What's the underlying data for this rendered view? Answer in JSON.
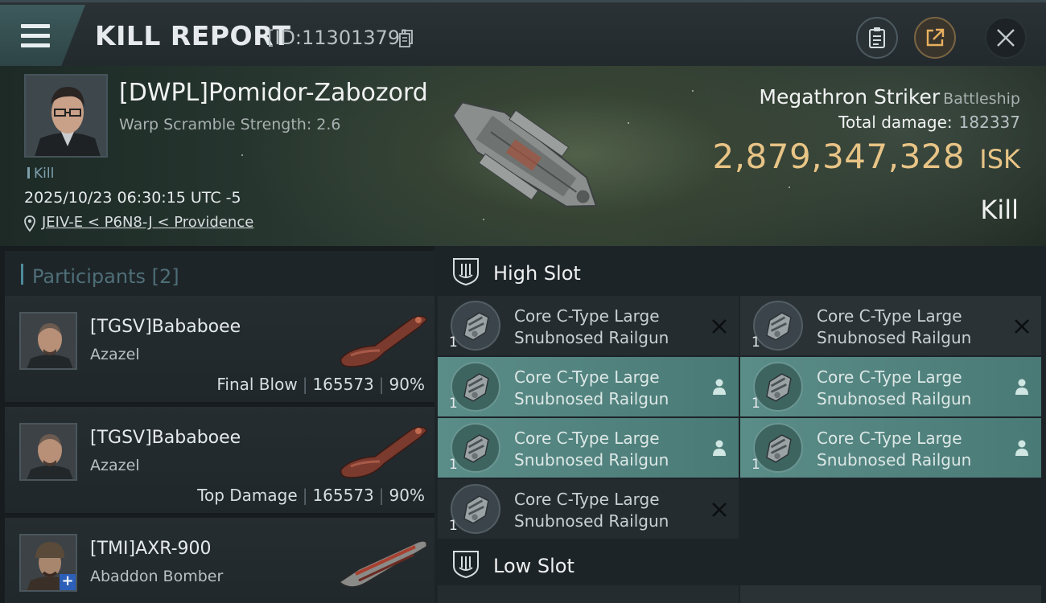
{
  "header": {
    "title": "KILL REPORT",
    "id_text": "[ID:11301379]"
  },
  "victim": {
    "name": "[DWPL]Pomidor-Zabozord",
    "warp_scramble": "Warp Scramble Strength: 2.6",
    "tag": "Kill",
    "datetime": "2025/10/23 06:30:15 UTC -5",
    "location": "JEIV-E < P6N8-J < Providence",
    "ship_name": "Megathron Striker",
    "ship_class": "Battleship",
    "total_damage_label": "Total damage:",
    "total_damage": "182337",
    "isk_value": "2,879,347,328",
    "isk_unit": "ISK",
    "result": "Kill"
  },
  "participants": {
    "label": "Participants",
    "count": "[2]",
    "rows": [
      {
        "name": "[TGSV]Bababoee",
        "ship": "Azazel",
        "role": "Final Blow",
        "damage": "165573",
        "percent": "90%"
      },
      {
        "name": "[TGSV]Bababoee",
        "ship": "Azazel",
        "role": "Top Damage",
        "damage": "165573",
        "percent": "90%"
      },
      {
        "name": "[TMI]AXR-900",
        "ship": "Abaddon Bomber"
      }
    ]
  },
  "slots": {
    "high_label": "High Slot",
    "low_label": "Low Slot",
    "high_modules": [
      {
        "line1": "Core C-Type Large",
        "line2": "Snubnosed Railgun",
        "qty": "1",
        "state": "destroyed"
      },
      {
        "line1": "Core C-Type Large",
        "line2": "Snubnosed Railgun",
        "qty": "1",
        "state": "destroyed"
      },
      {
        "line1": "Core C-Type Large",
        "line2": "Snubnosed Railgun",
        "qty": "1",
        "state": "dropped"
      },
      {
        "line1": "Core C-Type Large",
        "line2": "Snubnosed Railgun",
        "qty": "1",
        "state": "dropped"
      },
      {
        "line1": "Core C-Type Large",
        "line2": "Snubnosed Railgun",
        "qty": "1",
        "state": "dropped"
      },
      {
        "line1": "Core C-Type Large",
        "line2": "Snubnosed Railgun",
        "qty": "1",
        "state": "dropped"
      },
      {
        "line1": "Core C-Type Large",
        "line2": "Snubnosed Railgun",
        "qty": "1",
        "state": "destroyed"
      }
    ]
  },
  "icons": {
    "menu": "hamburger-icon",
    "copy": "copy-icon",
    "clipboard": "clipboard-icon",
    "share": "share-icon",
    "close": "close-icon",
    "location": "location-pin-icon",
    "slot": "shield-slot-icon",
    "destroyed": "x-icon",
    "dropped": "person-icon"
  },
  "colors": {
    "isk": "#e8c486",
    "accent": "#4f8a9a",
    "dropped_module_bg": "#5a8c88"
  }
}
